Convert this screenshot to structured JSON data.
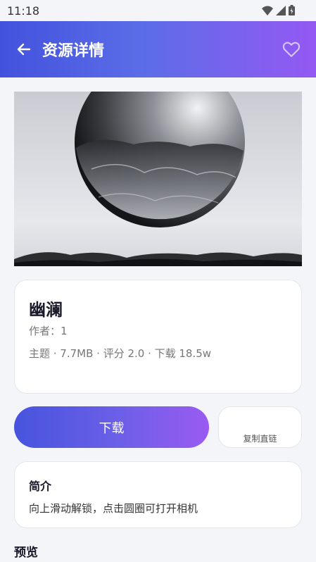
{
  "status_bar": {
    "time": "11:18"
  },
  "header": {
    "title": "资源详情"
  },
  "resource": {
    "title": "幽澜",
    "author": "作者：1",
    "meta": "主题 · 7.7MB · 评分 2.0 · 下载 18.5w"
  },
  "actions": {
    "download_label": "下载",
    "copy_link_label": "复制直链"
  },
  "intro": {
    "heading": "简介",
    "text": "向上滑动解锁，点击圆圈可打开相机"
  },
  "preview": {
    "heading": "预览"
  },
  "colors": {
    "accent_start": "#4352dd",
    "accent_end": "#9459f3",
    "background": "#f4f5f9"
  },
  "icons": [
    "wifi-icon",
    "signal-icon",
    "battery-icon",
    "back-arrow-icon",
    "heart-icon"
  ]
}
